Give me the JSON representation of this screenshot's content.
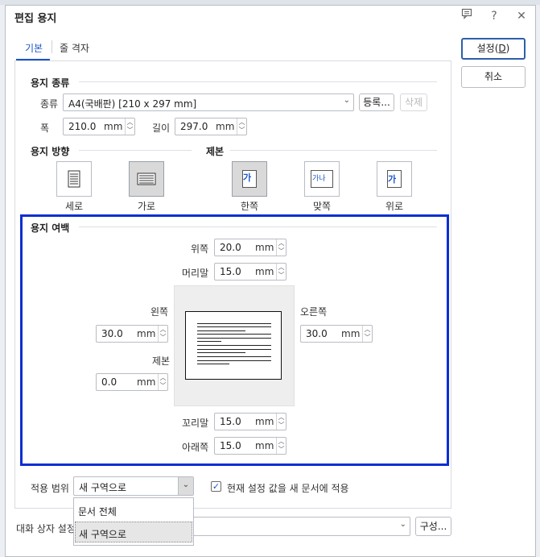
{
  "dialog": {
    "title": "편집 용지",
    "icons": {
      "comment": "comment-icon",
      "help": "help-icon",
      "close": "close-icon"
    },
    "help_glyph": "?",
    "close_glyph": "✕"
  },
  "tabs": [
    {
      "label": "기본",
      "active": true
    },
    {
      "label": "줄 격자",
      "active": false
    }
  ],
  "buttons": {
    "ok": "설정(D)",
    "ok_mnemonic_prefix": "설정(",
    "ok_mnemonic": "D",
    "ok_mnemonic_suffix": ")",
    "cancel": "취소",
    "register": "등록...",
    "delete": "삭제",
    "configure": "구성..."
  },
  "paper_type": {
    "section": "용지 종류",
    "type_label": "종류",
    "type_value": "A4(국배판)  [210 x 297 mm]",
    "width_label": "폭",
    "width_value": "210.0",
    "length_label": "길이",
    "length_value": "297.0",
    "unit": "mm"
  },
  "orientation": {
    "section": "용지 방향",
    "portrait": "세로",
    "landscape": "가로",
    "selected": "landscape"
  },
  "binding": {
    "section": "제본",
    "single": "한쪽",
    "facing": "맞쪽",
    "top": "위로",
    "selected": "single",
    "glyph_single": "가",
    "glyph_facing": "가나",
    "glyph_top": "가"
  },
  "margins": {
    "section": "용지 여백",
    "top_label": "위쪽",
    "top_value": "20.0",
    "header_label": "머리말",
    "header_value": "15.0",
    "left_label": "왼쪽",
    "left_value": "30.0",
    "binding_label": "제본",
    "binding_value": "0.0",
    "right_label": "오른쪽",
    "right_value": "30.0",
    "footer_label": "꼬리말",
    "footer_value": "15.0",
    "bottom_label": "아래쪽",
    "bottom_value": "15.0",
    "unit": "mm"
  },
  "apply": {
    "label": "적용 범위",
    "value": "새 구역으로",
    "options": [
      "문서 전체",
      "새 구역으로"
    ],
    "checkbox_label": "현재 설정 값을 새 문서에 적용",
    "checkbox_checked": true
  },
  "footer": {
    "label": "대화 상자 설정"
  },
  "colors": {
    "accent": "#1a55c9",
    "highlight_border": "#0a2fd1"
  }
}
